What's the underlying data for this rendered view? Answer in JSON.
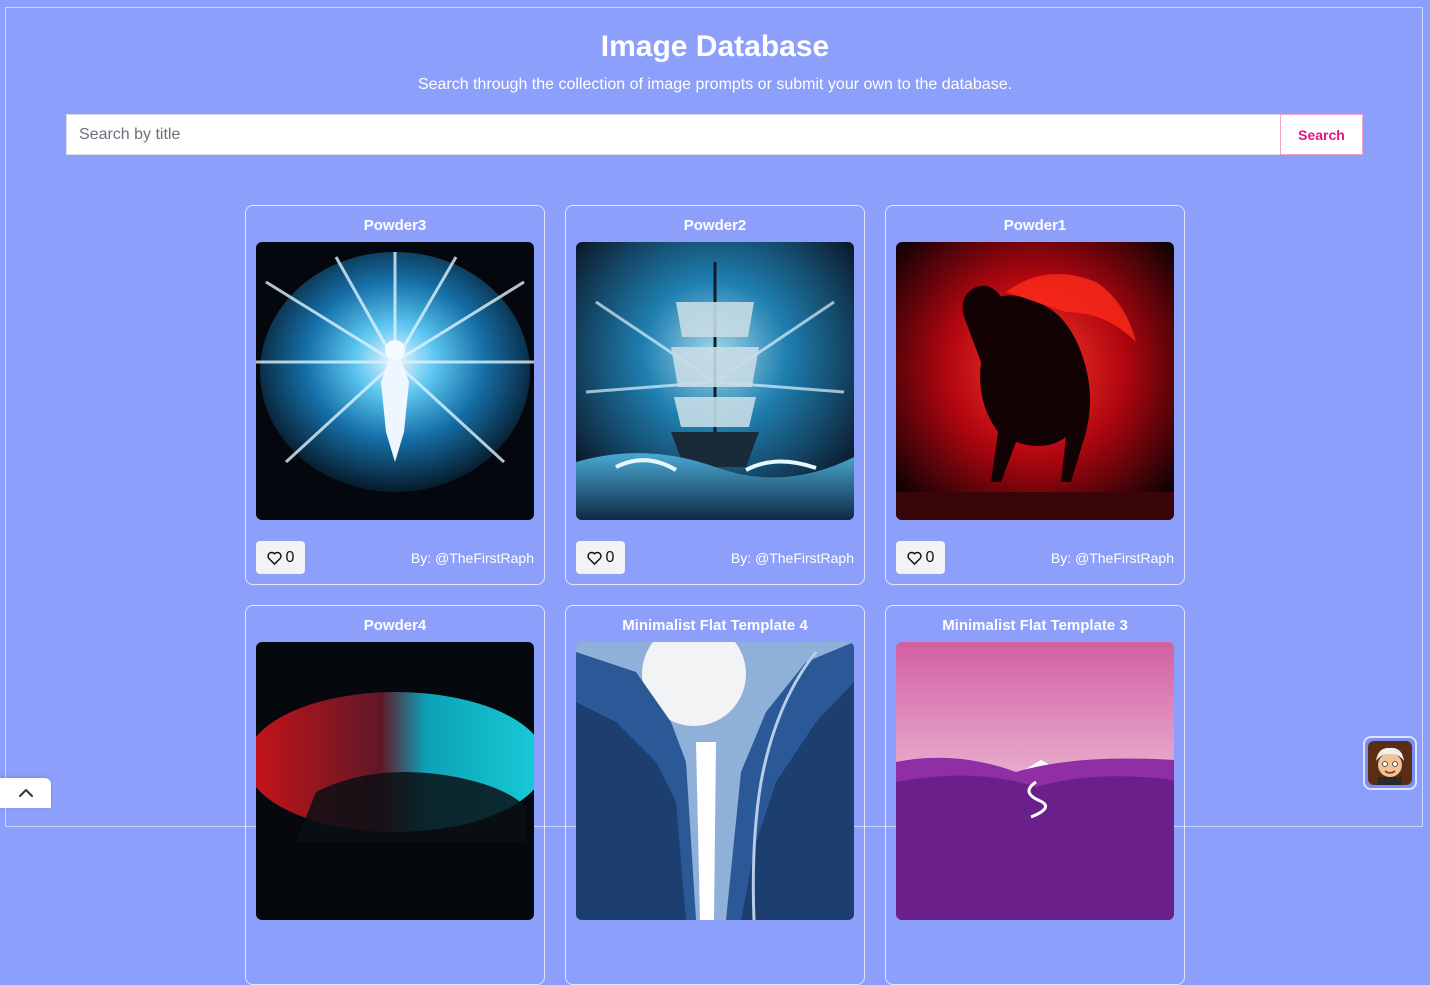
{
  "header": {
    "title": "Image Database",
    "subtitle": "Search through the collection of image prompts or submit your own to the database."
  },
  "search": {
    "placeholder": "Search by title",
    "value": "",
    "button_label": "Search"
  },
  "colors": {
    "background": "#8c9ffb",
    "accent": "#e0157e"
  },
  "cards": [
    {
      "title": "Powder3",
      "likes": "0",
      "author": "By: @TheFirstRaph"
    },
    {
      "title": "Powder2",
      "likes": "0",
      "author": "By: @TheFirstRaph"
    },
    {
      "title": "Powder1",
      "likes": "0",
      "author": "By: @TheFirstRaph"
    },
    {
      "title": "Powder4",
      "likes": "",
      "author": ""
    },
    {
      "title": "Minimalist Flat Template 4",
      "likes": "",
      "author": ""
    },
    {
      "title": "Minimalist Flat Template 3",
      "likes": "",
      "author": ""
    }
  ],
  "icons": {
    "like": "heart-icon",
    "scroll_top": "chevron-up-icon",
    "chat": "avatar-icon"
  }
}
